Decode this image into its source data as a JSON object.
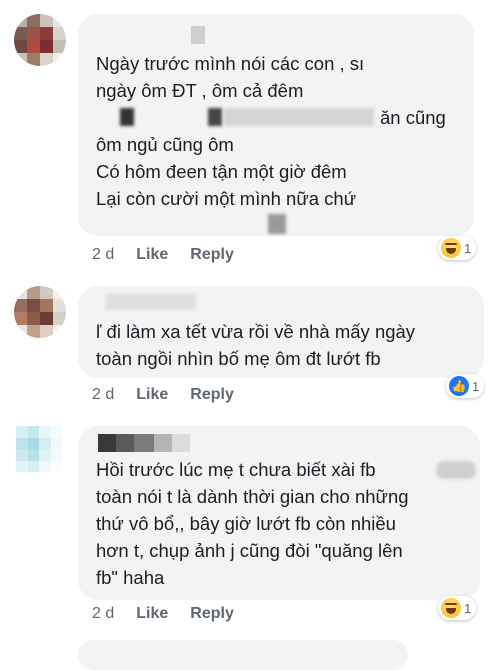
{
  "comments": [
    {
      "lines": [
        "Ngày trước mình nói các con , sı",
        "ngày ôm ĐT , ôm cả đêm",
        "ăn cũng",
        "ôm ngủ cũng ôm",
        "Có hôm đeen tận một giờ đêm",
        "Lại còn cười một mình nữa chứ"
      ],
      "time": "2 d",
      "like_label": "Like",
      "reply_label": "Reply",
      "reaction_count": "1",
      "reaction_icon": "haha-icon"
    },
    {
      "lines": [
        "ľ đi làm xa tết vừa rồi về nhà mấy ngày",
        "toàn ngồi nhìn bố mẹ ôm đt lướt fb"
      ],
      "time": "2 d",
      "like_label": "Like",
      "reply_label": "Reply",
      "reaction_count": "1",
      "reaction_icon": "like-icon"
    },
    {
      "lines": [
        "Hồi trước lúc mẹ t chưa biết xài fb",
        "toàn nói t là dành thời gian cho những",
        "thứ vô bổ,, bây giờ lướt fb còn nhiều",
        "hơn t, chụp ảnh j cũng đòi \"quăng lên",
        "fb\" haha"
      ],
      "time": "2 d",
      "like_label": "Like",
      "reply_label": "Reply",
      "reaction_count": "1",
      "reaction_icon": "haha-icon"
    }
  ],
  "colors": {
    "bubble": "#f2f3f5",
    "text": "#1c1e21",
    "meta": "#606770",
    "like_blue": "#1877f2"
  }
}
